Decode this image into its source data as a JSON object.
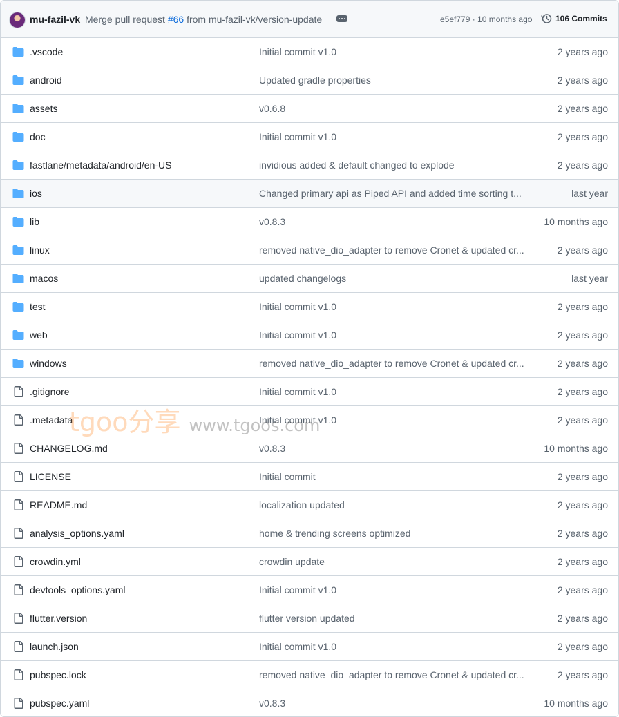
{
  "latest_commit": {
    "author": "mu-fazil-vk",
    "message_prefix": "Merge pull request ",
    "pr_number": "#66",
    "message_suffix": " from mu-fazil-vk/version-update",
    "sha_and_time": "e5ef779 · 10 months ago",
    "commits_label": "106 Commits"
  },
  "files": [
    {
      "type": "folder",
      "name": ".vscode",
      "message": "Initial commit v1.0",
      "date": "2 years ago"
    },
    {
      "type": "folder",
      "name": "android",
      "message": "Updated gradle properties",
      "date": "2 years ago"
    },
    {
      "type": "folder",
      "name": "assets",
      "message": "v0.6.8",
      "date": "2 years ago"
    },
    {
      "type": "folder",
      "name": "doc",
      "message": "Initial commit v1.0",
      "date": "2 years ago"
    },
    {
      "type": "folder",
      "name": "fastlane/metadata/android/en-US",
      "message": "invidious added & default changed to explode",
      "date": "2 years ago"
    },
    {
      "type": "folder",
      "name": "ios",
      "message": "Changed primary api as Piped API and added time sorting t...",
      "date": "last year"
    },
    {
      "type": "folder",
      "name": "lib",
      "message": "v0.8.3",
      "date": "10 months ago"
    },
    {
      "type": "folder",
      "name": "linux",
      "message": "removed native_dio_adapter to remove Cronet & updated cr...",
      "date": "2 years ago"
    },
    {
      "type": "folder",
      "name": "macos",
      "message": "updated changelogs",
      "date": "last year"
    },
    {
      "type": "folder",
      "name": "test",
      "message": "Initial commit v1.0",
      "date": "2 years ago"
    },
    {
      "type": "folder",
      "name": "web",
      "message": "Initial commit v1.0",
      "date": "2 years ago"
    },
    {
      "type": "folder",
      "name": "windows",
      "message": "removed native_dio_adapter to remove Cronet & updated cr...",
      "date": "2 years ago"
    },
    {
      "type": "file",
      "name": ".gitignore",
      "message": "Initial commit v1.0",
      "date": "2 years ago"
    },
    {
      "type": "file",
      "name": ".metadata",
      "message": "Initial commit v1.0",
      "date": "2 years ago"
    },
    {
      "type": "file",
      "name": "CHANGELOG.md",
      "message": "v0.8.3",
      "date": "10 months ago"
    },
    {
      "type": "file",
      "name": "LICENSE",
      "message": "Initial commit",
      "date": "2 years ago"
    },
    {
      "type": "file",
      "name": "README.md",
      "message": "localization updated",
      "date": "2 years ago"
    },
    {
      "type": "file",
      "name": "analysis_options.yaml",
      "message": "home & trending screens optimized",
      "date": "2 years ago"
    },
    {
      "type": "file",
      "name": "crowdin.yml",
      "message": "crowdin update",
      "date": "2 years ago"
    },
    {
      "type": "file",
      "name": "devtools_options.yaml",
      "message": "Initial commit v1.0",
      "date": "2 years ago"
    },
    {
      "type": "file",
      "name": "flutter.version",
      "message": "flutter version updated",
      "date": "2 years ago"
    },
    {
      "type": "file",
      "name": "launch.json",
      "message": "Initial commit v1.0",
      "date": "2 years ago"
    },
    {
      "type": "file",
      "name": "pubspec.lock",
      "message": "removed native_dio_adapter to remove Cronet & updated cr...",
      "date": "2 years ago"
    },
    {
      "type": "file",
      "name": "pubspec.yaml",
      "message": "v0.8.3",
      "date": "10 months ago"
    }
  ],
  "hovered_row": 5,
  "colors": {
    "folder": "#54aeff",
    "file": "#59636e",
    "link": "#0969da",
    "border": "#d0d7de"
  },
  "icons": {
    "folder": "folder-icon",
    "file": "file-icon",
    "history": "history-icon",
    "ellipsis": "ellipsis-icon"
  },
  "watermark": {
    "brand": "tgoo分享",
    "site": "www.tgoos.com"
  }
}
